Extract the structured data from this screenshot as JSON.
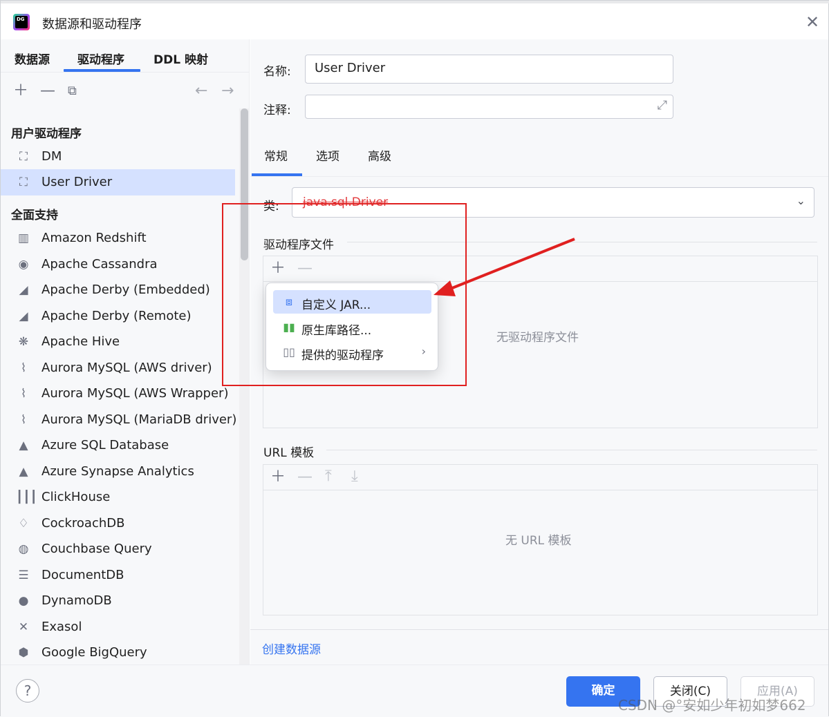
{
  "window": {
    "title": "数据源和驱动程序"
  },
  "left_tabs": [
    "数据源",
    "驱动程序",
    "DDL 映射"
  ],
  "groups": {
    "user": "用户驱动程序",
    "full": "全面支持"
  },
  "user_drivers": [
    {
      "label": "DM",
      "icon": "driver-icon"
    },
    {
      "label": "User Driver",
      "icon": "driver-icon",
      "selected": true
    }
  ],
  "full_drivers": [
    {
      "label": "Amazon Redshift",
      "icon": "redshift-icon"
    },
    {
      "label": "Apache Cassandra",
      "icon": "cassandra-icon"
    },
    {
      "label": "Apache Derby (Embedded)",
      "icon": "derby-icon"
    },
    {
      "label": "Apache Derby (Remote)",
      "icon": "derby-icon"
    },
    {
      "label": "Apache Hive",
      "icon": "hive-icon"
    },
    {
      "label": "Aurora MySQL (AWS driver)",
      "icon": "mysql-icon"
    },
    {
      "label": "Aurora MySQL (AWS Wrapper)",
      "icon": "mysql-icon"
    },
    {
      "label": "Aurora MySQL (MariaDB driver)",
      "icon": "mysql-icon"
    },
    {
      "label": "Azure SQL Database",
      "icon": "azure-icon"
    },
    {
      "label": "Azure Synapse Analytics",
      "icon": "azure-icon"
    },
    {
      "label": "ClickHouse",
      "icon": "clickhouse-icon"
    },
    {
      "label": "CockroachDB",
      "icon": "cockroach-icon"
    },
    {
      "label": "Couchbase Query",
      "icon": "couchbase-icon"
    },
    {
      "label": "DocumentDB",
      "icon": "documentdb-icon"
    },
    {
      "label": "DynamoDB",
      "icon": "dynamodb-icon"
    },
    {
      "label": "Exasol",
      "icon": "exasol-icon"
    },
    {
      "label": "Google BigQuery",
      "icon": "bigquery-icon"
    }
  ],
  "form": {
    "name_label": "名称:",
    "name_value": "User Driver",
    "comment_label": "注释:",
    "comment_value": ""
  },
  "right_tabs": [
    "常规",
    "选项",
    "高级"
  ],
  "class": {
    "label": "类:",
    "value": "java.sql.Driver"
  },
  "driver_files": {
    "title": "驱动程序文件",
    "empty": "无驱动程序文件"
  },
  "url_templates": {
    "title": "URL 模板",
    "empty": "无 URL 模板"
  },
  "popup_menu": [
    {
      "label": "自定义 JAR...",
      "icon": "jar-icon",
      "highlighted": true
    },
    {
      "label": "原生库路径...",
      "icon": "native-library-icon"
    },
    {
      "label": "提供的驱动程序",
      "icon": "provided-drivers-icon",
      "submenu": true
    }
  ],
  "create_link": "创建数据源",
  "footer": {
    "help": "?",
    "ok": "确定",
    "cancel": "关闭(C)",
    "apply": "应用(A)"
  },
  "watermark": "CSDN @°安如少年初如梦662",
  "colors": {
    "accent": "#3574f0",
    "error": "#e3393c",
    "annotation": "#e02020",
    "selection": "#d5e1ff"
  }
}
